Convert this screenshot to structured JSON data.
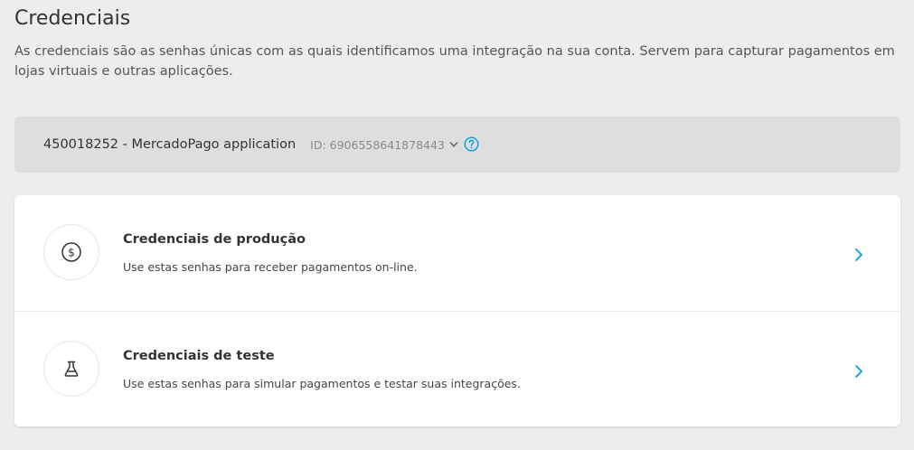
{
  "header": {
    "title": "Credenciais",
    "description": "As credenciais são as senhas únicas com as quais identificamos uma integração na sua conta. Servem para capturar pagamentos em lojas virtuais e outras aplicações."
  },
  "app_selector": {
    "name": "450018252 - MercadoPago application",
    "id_label": "ID: 6906558641878443",
    "chevron_icon": "chevron-down-icon",
    "help_icon": "question-circle-icon"
  },
  "credentials": [
    {
      "icon": "dollar-circle-icon",
      "title": "Credenciais de produção",
      "subtitle": "Use estas senhas para receber pagamentos on-line."
    },
    {
      "icon": "flask-icon",
      "title": "Credenciais de teste",
      "subtitle": "Use estas senhas para simular pagamentos e testar suas integrações."
    }
  ],
  "colors": {
    "background": "#ededed",
    "selector_bg": "#dedede",
    "card_bg": "#ffffff",
    "accent": "#009ee3",
    "text": "#333333"
  }
}
